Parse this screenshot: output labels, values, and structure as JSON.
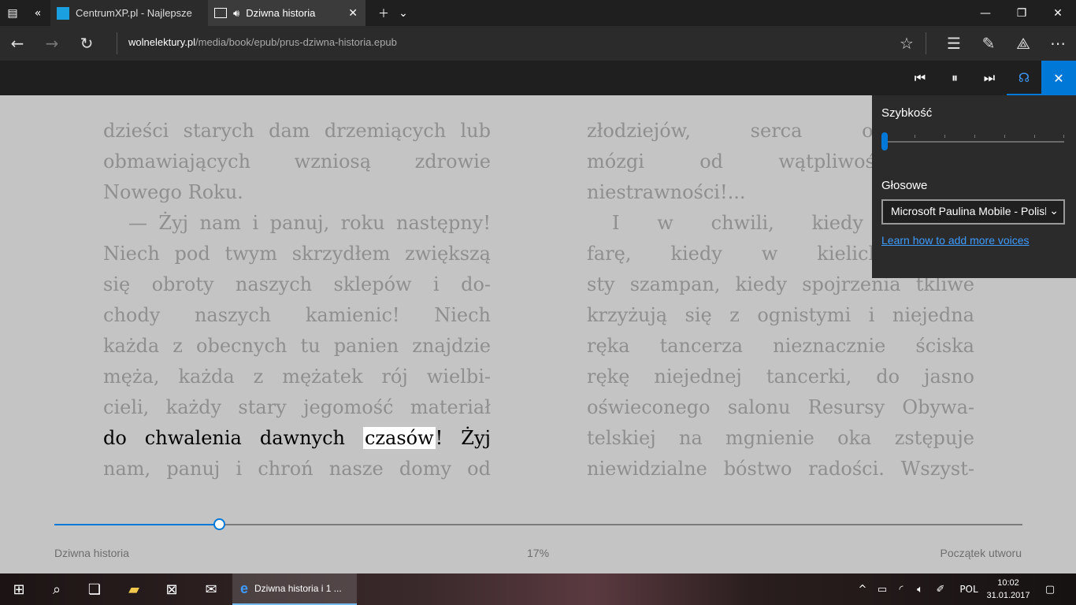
{
  "tabs": [
    {
      "title": "CentrumXP.pl - Najlepsze",
      "icon": "centrumxp-logo-icon"
    },
    {
      "title": "Dziwna historia",
      "icon": "reading-view-icon"
    }
  ],
  "address": {
    "host": "wolnelektury.pl",
    "path": "/media/book/epub/prus-dziwna-historia.epub"
  },
  "book": {
    "left_lines": [
      "dzieści starych dam drzemiących lub",
      "obmawiających wzniosą zdrowie",
      "Nowego Roku.",
      "— Żyj nam i panuj, roku następny!",
      "Niech pod twym skrzydłem zwiększą",
      "się obroty naszych sklepów i do-",
      "chody naszych kamienic! Niech",
      "każda z obecnych tu panien znajdzie",
      "męża, każda z mężatek rój wielbi-",
      "cieli, każdy stary jegomość materiał"
    ],
    "current_line_before": "do chwalenia dawnych",
    "current_word": "czasów",
    "current_line_after": "! Żyj",
    "left_last_line": "nam, panuj i chroń nasze domy od",
    "right_lines": [
      "złodziejów, serca od nie",
      "mózgi od wątpliwości, żo",
      "niestrawności!...",
      "I w chwili, kiedy muzyka",
      "farę, kiedy w kielichach sy",
      "sty szampan, kiedy spojrzenia tkliwe",
      "krzyżują się z ognistymi i niejedna",
      "ręka tancerza nieznacznie ściska",
      "rękę niejednej tancerki, do jasno",
      "oświeconego salonu Resursy Obywa-",
      "telskiej na mgnienie oka zstępuje",
      "niewidzialne bóstwo radości. Wszyst-"
    ]
  },
  "footer": {
    "title": "Dziwna historia",
    "percent": "17%",
    "progress": 0.17,
    "chapter": "Początek utworu"
  },
  "read_aloud": {
    "speed_label": "Szybkość",
    "speed_value": 0,
    "voices_label": "Głosowe",
    "voice_selected": "Microsoft Paulina Mobile - Polish",
    "learn_link": "Learn how to add more voices"
  },
  "taskbar": {
    "edge_item": "Dziwna historia i 1 ...",
    "language": "POL",
    "time": "10:02",
    "date": "31.01.2017"
  },
  "colors": {
    "accent": "#0078d7",
    "link": "#3d9bff"
  }
}
